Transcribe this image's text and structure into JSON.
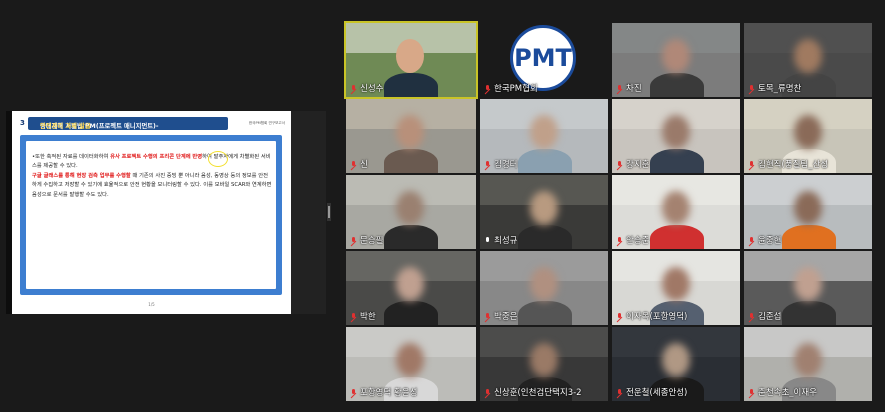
{
  "slide": {
    "number": "3",
    "title_prefix": "중대재해 처벌법 PM(프로젝트 매니지먼트)-",
    "title_highlight": "안전관리 과제 발굴",
    "source": "한국PM협회 연구보고서",
    "p1_a": "•또한 축적된 자료를 데이터화하여 ",
    "p1_red": "유사 프로젝트 수행의 프리콘 단계에 반영",
    "p1_b": "하여 발주자에게 차별화된 서비스를 제공할 수 있다.",
    "p2_red": "구글 글래스를 통해 현장 검측 업무를 수행할",
    "p2_b": " 때 기존의 사진 증빙 뿐 아니라 음성, 동영상 등의 정보를 안전하게 수집하고 저장할 수 있기에 효율적으로 안전 현황을 모니터링할 수 있다. 이를 모바일 SCAR와 연계하면 음성으로 문서를 발행할 수도 있다.",
    "page": "1/5"
  },
  "participants": [
    {
      "name": "신성수",
      "muted": true,
      "active": true
    },
    {
      "name": "한국PM협회",
      "muted": true
    },
    {
      "name": "차진",
      "muted": true
    },
    {
      "name": "토목_류명찬",
      "muted": true
    },
    {
      "name": "신",
      "muted": true
    },
    {
      "name": "김경터",
      "muted": true
    },
    {
      "name": "강지훈",
      "muted": true
    },
    {
      "name": "김현직(풍질팀_산성",
      "muted": true
    },
    {
      "name": "문승필",
      "muted": true
    },
    {
      "name": "최성규",
      "muted": false
    },
    {
      "name": "안승준",
      "muted": true
    },
    {
      "name": "윤중현",
      "muted": true
    },
    {
      "name": "박한",
      "muted": true
    },
    {
      "name": "박중은",
      "muted": true
    },
    {
      "name": "이자옥(포항영덕)",
      "muted": true
    },
    {
      "name": "김준섭",
      "muted": true
    },
    {
      "name": "포항영덕 황윤성",
      "muted": true
    },
    {
      "name": "신상훈(인천검단택지3-2",
      "muted": true
    },
    {
      "name": "전운철(세종안성)",
      "muted": true
    },
    {
      "name": "춘천속초_이재우",
      "muted": true
    }
  ],
  "logo_text": "PMT",
  "colors": {
    "accent_border": "#c9c427",
    "muted_icon": "#e03030",
    "slide_title_bg": "#1f4e8e"
  }
}
